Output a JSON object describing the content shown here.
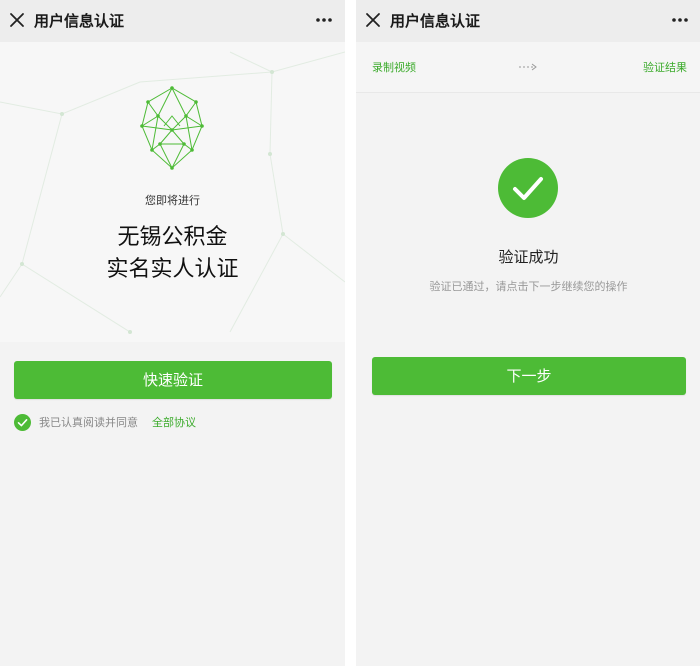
{
  "colors": {
    "accent": "#4dbb36",
    "link": "#3cab2c",
    "navbar": "#ededed",
    "background": "#f3f3f3"
  },
  "left_screen": {
    "navbar": {
      "title": "用户信息认证",
      "close_icon": "close-icon",
      "more_icon": "more-dots-icon"
    },
    "hero": {
      "face_icon": "face-mesh-icon",
      "intro": "您即将进行",
      "title_line1": "无锡公积金",
      "title_line2": "实名实人认证"
    },
    "primary_button": "快速验证",
    "agreement": {
      "check_icon": "checkmark-circle-icon",
      "text": "我已认真阅读并同意",
      "link": "全部协议"
    }
  },
  "right_screen": {
    "navbar": {
      "title": "用户信息认证",
      "close_icon": "close-icon",
      "more_icon": "more-dots-icon"
    },
    "steps": {
      "step1": "录制视频",
      "arrow_icon": "dotted-arrow-icon",
      "step2": "验证结果"
    },
    "result": {
      "icon": "success-check-icon",
      "title": "验证成功",
      "description": "验证已通过，请点击下一步继续您的操作"
    },
    "primary_button": "下一步"
  }
}
